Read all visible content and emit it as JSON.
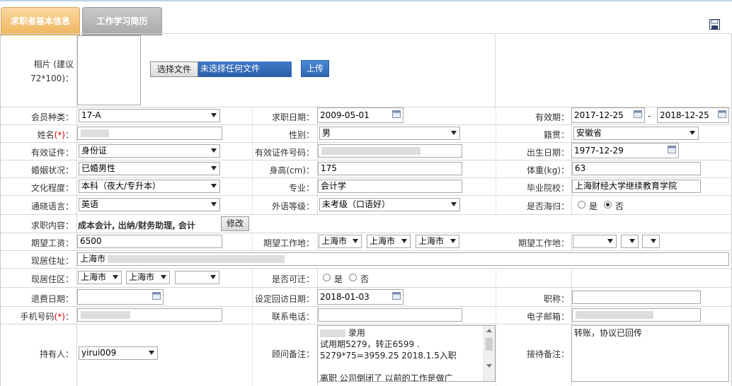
{
  "tabs": {
    "basic": "求职者基本信息",
    "history": "工作学习简历"
  },
  "photo": {
    "label_line1": "相片 (建议",
    "label_line2": "72*100)：",
    "choose_file": "选择文件",
    "no_file": "未选择任何文件",
    "upload": "上传"
  },
  "member_type": {
    "label": "会员种类：",
    "value": "17-A"
  },
  "job_date": {
    "label": "求职日期：",
    "value": "2009-05-01"
  },
  "valid_period": {
    "label": "有效期：",
    "start": "2017-12-25",
    "sep": "-",
    "end": "2018-12-25"
  },
  "name": {
    "label": "姓名",
    "star": "(*)",
    "colon": "："
  },
  "gender": {
    "label": "性别：",
    "value": "男"
  },
  "native": {
    "label": "籍贯：",
    "value": "安徽省"
  },
  "id_type": {
    "label": "有效证件：",
    "value": "身份证"
  },
  "id_no": {
    "label": "有效证件号码："
  },
  "birth": {
    "label": "出生日期：",
    "value": "1977-12-29"
  },
  "marital": {
    "label": "婚姻状况：",
    "value": "已婚男性"
  },
  "height": {
    "label": "身高(cm)：",
    "value": "175"
  },
  "weight": {
    "label": "体重(kg)：",
    "value": "63"
  },
  "education": {
    "label": "文化程度：",
    "value": "本科（夜大/专升本）"
  },
  "major": {
    "label": "专业：",
    "value": "会计学"
  },
  "school": {
    "label": "毕业院校：",
    "value": "上海财经大学继续教育学院"
  },
  "language": {
    "label": "通晓语言：",
    "value": "英语"
  },
  "lang_level": {
    "label": "外语等级：",
    "value": "未考级（口语好）"
  },
  "overseas": {
    "label": "是否海归：",
    "yes": "是",
    "no": "否"
  },
  "job_content": {
    "label": "求职内容：",
    "value": "成本会计, 出纳/财务助理, 会计",
    "modify": "修改"
  },
  "salary": {
    "label": "期望工资：",
    "value": "6500"
  },
  "work_place1": {
    "label": "期望工作地：",
    "v1": "上海市",
    "v2": "上海市",
    "v3": "上海市"
  },
  "work_place2": {
    "label": "期望工作地："
  },
  "address": {
    "label": "现居住址：",
    "value": "上海市"
  },
  "district": {
    "label": "现居住区：",
    "v1": "上海市",
    "v2": "上海市"
  },
  "relocate": {
    "label": "是否可迁：",
    "yes": "是",
    "no": "否"
  },
  "refund_date": {
    "label": "退费日期："
  },
  "revisit_date": {
    "label": "设定回访日期：",
    "value": "2018-01-03"
  },
  "title": {
    "label": "职称："
  },
  "mobile": {
    "label": "手机号码",
    "star": "(*)",
    "colon": "："
  },
  "phone": {
    "label": "联系电话："
  },
  "email": {
    "label": "电子邮箱："
  },
  "holder": {
    "label": "持有人：",
    "value": "yirui009"
  },
  "consultant_note": {
    "label": "顾问备注：",
    "line1": "录用",
    "line2": "试用期5279，转正6599 .",
    "line3": "5279*75=3959.25  2018.1.5入职",
    "line4": "",
    "line5": "离职 公司倒闭了 以前的工作是做广"
  },
  "reception_note": {
    "label": "接待备注：",
    "value": "转账，协议已回传"
  }
}
